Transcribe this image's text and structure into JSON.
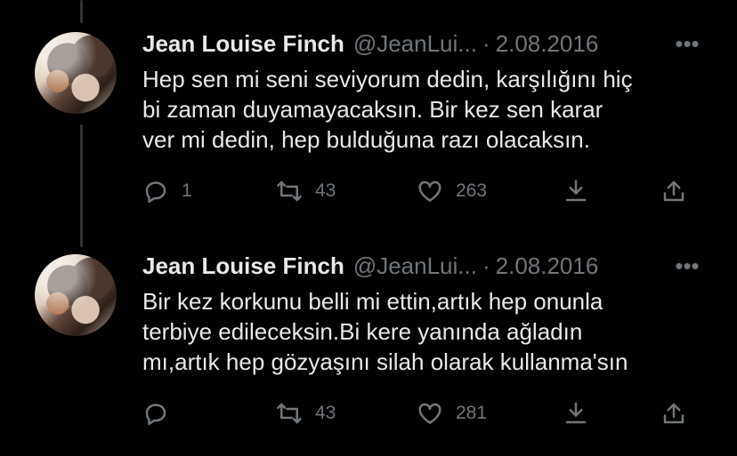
{
  "tweets": [
    {
      "name": "Jean Louise Finch",
      "handle": "@JeanLui...",
      "separator": "·",
      "date": "2.08.2016",
      "more": "•••",
      "lines": [
        "Hep sen mi seni seviyorum dedin, karşılığını hiç",
        "bi zaman duyamayacaksın. Bir kez sen karar",
        "ver mi dedin, hep bulduğuna razı olacaksın."
      ],
      "replies": "1",
      "retweets": "43",
      "likes": "263",
      "icons": [
        "reply-icon",
        "retweet-icon",
        "like-icon",
        "download-icon",
        "share-icon"
      ]
    },
    {
      "name": "Jean Louise Finch",
      "handle": "@JeanLui...",
      "separator": "·",
      "date": "2.08.2016",
      "more": "•••",
      "lines": [
        "Bir kez korkunu belli mi ettin,artık hep onunla",
        "terbiye edileceksin.Bi kere yanında ağladın",
        "mı,artık hep gözyaşını silah olarak kullanma'sın"
      ],
      "replies": "",
      "retweets": "43",
      "likes": "281",
      "icons": [
        "reply-icon",
        "retweet-icon",
        "like-icon",
        "download-icon",
        "share-icon"
      ]
    }
  ],
  "colors": {
    "background": "#000000",
    "text": "#e7e9ea",
    "secondary": "#71767b",
    "thread_line": "#2f3336"
  }
}
